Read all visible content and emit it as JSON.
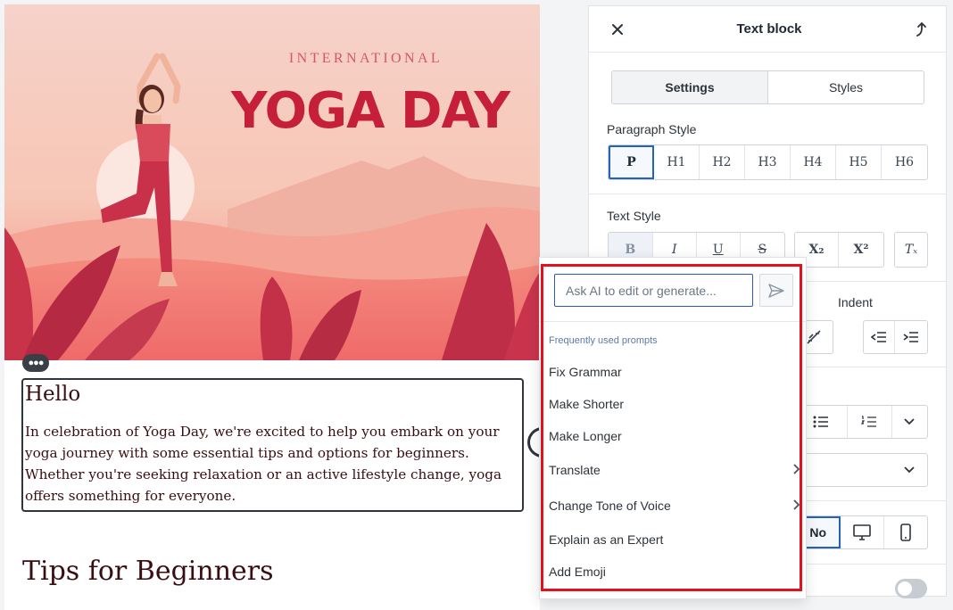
{
  "hero": {
    "subtitle": "INTERNATIONAL",
    "title": "YOGA DAY"
  },
  "text_block": {
    "heading": "Hello",
    "body": "In celebration of Yoga Day, we're excited to help you embark on your yoga journey with some essential tips and options for beginners. Whether you're seeking relaxation or an active lifestyle change, yoga offers something for everyone."
  },
  "tips_heading": "Tips for Beginners",
  "panel": {
    "title": "Text block",
    "tabs": [
      "Settings",
      "Styles"
    ],
    "paragraph_style": {
      "label": "Paragraph Style",
      "options": [
        "P",
        "H1",
        "H2",
        "H3",
        "H4",
        "H5",
        "H6"
      ],
      "selected": "P"
    },
    "text_style": {
      "label": "Text Style",
      "options": [
        "B",
        "I",
        "U",
        "S"
      ],
      "script": [
        "X₂",
        "X²"
      ],
      "clear": "Tₓ"
    },
    "indent_label": "Indent",
    "visibility_selected": "No"
  },
  "ai": {
    "placeholder": "Ask AI to edit or generate...",
    "section_label": "Frequently used prompts",
    "prompts": [
      {
        "label": "Fix Grammar",
        "submenu": false
      },
      {
        "label": "Make Shorter",
        "submenu": false
      },
      {
        "label": "Make Longer",
        "submenu": false
      },
      {
        "label": "Translate",
        "submenu": true
      },
      {
        "label": "Change Tone of Voice",
        "submenu": true
      },
      {
        "label": "Explain as an Expert",
        "submenu": false
      },
      {
        "label": "Add Emoji",
        "submenu": false
      }
    ],
    "highlight_color": "#e3101d"
  },
  "colors": {
    "accent_blue": "#2563b8",
    "hero_red": "#c51f3a"
  }
}
